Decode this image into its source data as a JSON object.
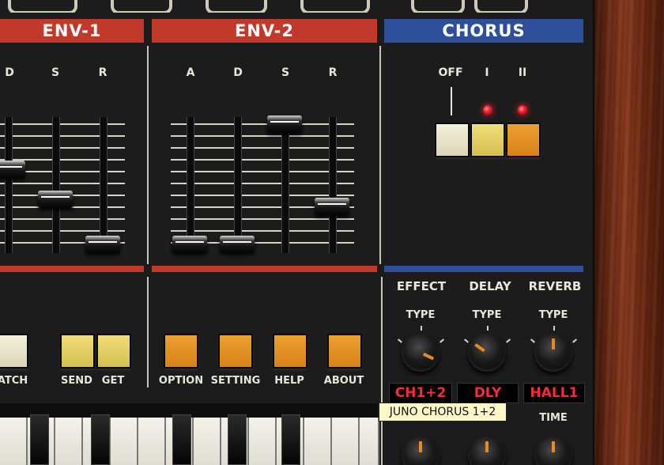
{
  "sections": {
    "env1": "ENV-1",
    "env2": "ENV-2",
    "chorus": "CHORUS"
  },
  "env1_labels": [
    "D",
    "S",
    "R"
  ],
  "env2_labels": [
    "A",
    "D",
    "S",
    "R"
  ],
  "chorus_labels": [
    "OFF",
    "I",
    "II"
  ],
  "bottom_buttons": {
    "patch": "ATCH",
    "send": "SEND",
    "get": "GET",
    "option": "OPTION",
    "setting": "SETTING",
    "help": "HELP",
    "about": "ABOUT"
  },
  "effects": {
    "headers": [
      "EFFECT",
      "DELAY",
      "REVERB"
    ],
    "type_label": "TYPE",
    "displays": [
      "CH1+2",
      "DLY",
      "HALL1"
    ],
    "time_label": "TIME"
  },
  "tooltip": "JUNO CHORUS 1+2",
  "colors": {
    "red": "#c2382a",
    "blue": "#2e4f9a",
    "display_text": "#ff2838",
    "led": "#ff2030"
  }
}
